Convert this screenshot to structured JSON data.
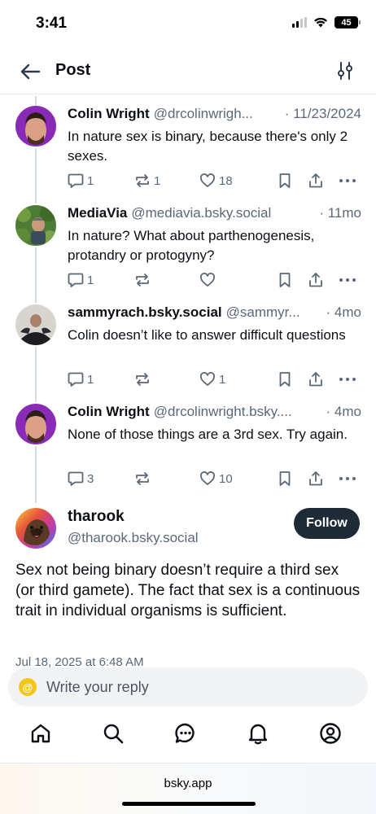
{
  "status_bar": {
    "time": "3:41",
    "battery": "45"
  },
  "header": {
    "title": "Post"
  },
  "thread": [
    {
      "name": "Colin Wright",
      "handle": "@drcolinwrigh...",
      "time": "· 11/23/2024",
      "text": "In nature sex is binary, because there's only 2 sexes.",
      "replies": "1",
      "reposts": "1",
      "likes": "18"
    },
    {
      "name": "MediaVia",
      "handle": "@mediavia.bsky.social",
      "time": "· 11mo",
      "text": "In nature? What about parthenogenesis, protandry or protogyny?",
      "replies": "1",
      "reposts": "",
      "likes": ""
    },
    {
      "name": "sammyrach.bsky.social",
      "handle": "@sammyr...",
      "time": "· 4mo",
      "text": "Colin doesn’t like to answer difficult questions",
      "replies": "1",
      "reposts": "",
      "likes": "1"
    },
    {
      "name": "Colin Wright",
      "handle": "@drcolinwright.bsky....",
      "time": "· 4mo",
      "text": "None of those things are a 3rd sex. Try again.",
      "replies": "3",
      "reposts": "",
      "likes": "10"
    }
  ],
  "main_post": {
    "name": "tharook",
    "handle": "@tharook.bsky.social",
    "follow_label": "Follow",
    "text": "Sex not being binary doesn’t require a third sex (or third gamete). The fact that sex is a continuous trait in individual organisms is sufficient.",
    "date": "Jul 18, 2025 at 6:48 AM"
  },
  "reply_bar": {
    "placeholder": "Write your reply",
    "avatar_glyph": "@"
  },
  "tabs": [
    "home-icon",
    "search-icon",
    "chat-icon",
    "bell-icon",
    "profile-icon"
  ],
  "browser": {
    "url": "bsky.app"
  },
  "colors": {
    "text": "#0b0f14",
    "muted": "#5b6878",
    "follow_bg": "#1f2a37",
    "reply_bar_bg": "#f1f3f5",
    "accent": "#1083fe"
  }
}
